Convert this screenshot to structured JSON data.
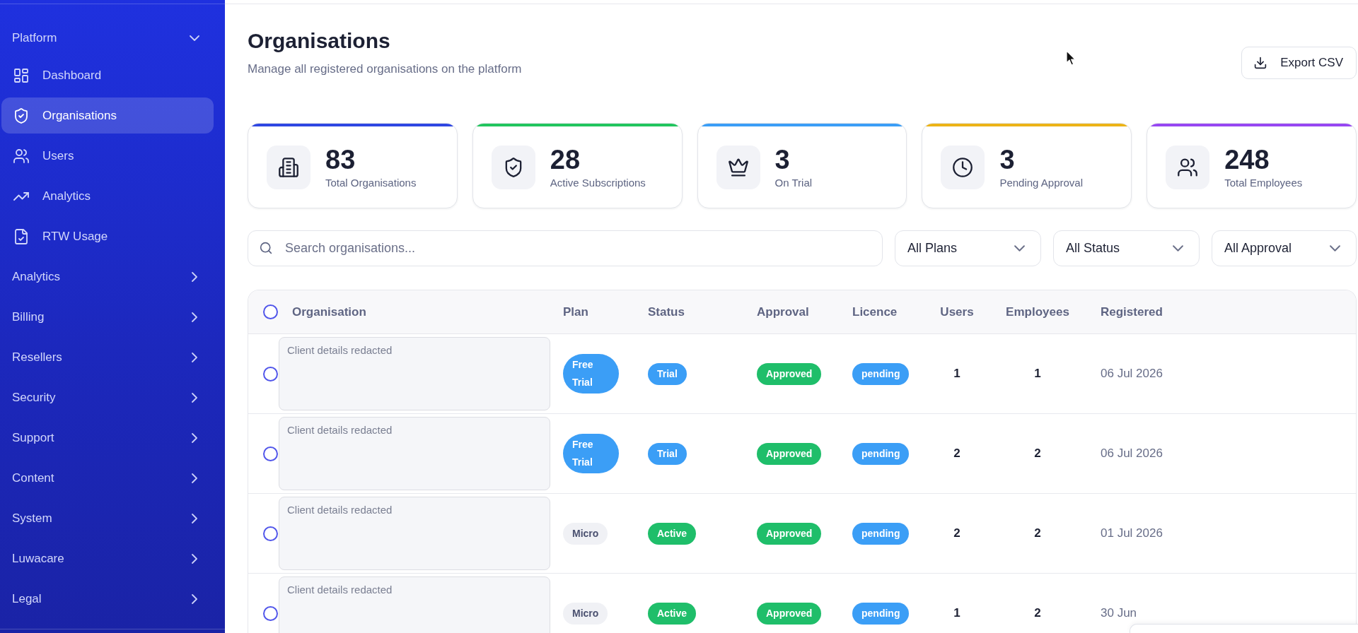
{
  "sidebar": {
    "sections": [
      {
        "label": "Platform",
        "expanded": true,
        "children": [
          {
            "label": "Dashboard",
            "selected": false
          },
          {
            "label": "Organisations",
            "selected": true
          },
          {
            "label": "Users",
            "selected": false
          },
          {
            "label": "Analytics",
            "selected": false
          },
          {
            "label": "RTW Usage",
            "selected": false
          }
        ]
      },
      {
        "label": "Analytics",
        "expanded": false
      },
      {
        "label": "Billing",
        "expanded": false
      },
      {
        "label": "Resellers",
        "expanded": false
      },
      {
        "label": "Security",
        "expanded": false
      },
      {
        "label": "Support",
        "expanded": false
      },
      {
        "label": "Content",
        "expanded": false
      },
      {
        "label": "System",
        "expanded": false
      },
      {
        "label": "Luwacare",
        "expanded": false
      },
      {
        "label": "Legal",
        "expanded": false
      }
    ]
  },
  "header": {
    "title": "Organisations",
    "subtitle": "Manage all registered organisations on the platform",
    "export_button": "Export CSV"
  },
  "stats": [
    {
      "value": "83",
      "label": "Total Organisations",
      "color": "#2f47e2"
    },
    {
      "value": "28",
      "label": "Active Subscriptions",
      "color": "#22c55e"
    },
    {
      "value": "3",
      "label": "On Trial",
      "color": "#3b9ef6"
    },
    {
      "value": "3",
      "label": "Pending Approval",
      "color": "#ecb316"
    },
    {
      "value": "248",
      "label": "Total Employees",
      "color": "#9747f2"
    }
  ],
  "filters": {
    "search": {
      "placeholder": "Search organisations..."
    },
    "dropdowns": [
      {
        "value": "All Plans"
      },
      {
        "value": "All Status"
      },
      {
        "value": "All Approval"
      }
    ]
  },
  "table": {
    "select_all": {
      "checked": false
    },
    "columns": [
      "Organisation",
      "Plan",
      "Status",
      "Approval",
      "Licence",
      "Users",
      "Employees",
      "Registered"
    ],
    "rows": [
      {
        "selected": false,
        "organisation": "Client details redacted",
        "plan": {
          "text": "Free Trial",
          "color": "#3b9ef6"
        },
        "status": {
          "text": "Trial",
          "color": "#3b9ef6"
        },
        "approval": {
          "text": "Approved",
          "color": "#1fbe6a"
        },
        "licence": {
          "text": "pending",
          "color": "#3b9ef6"
        },
        "users": "1",
        "employees": "1",
        "registered": "06 Jul 2026"
      },
      {
        "selected": false,
        "organisation": "Client details redacted",
        "plan": {
          "text": "Free Trial",
          "color": "#3b9ef6"
        },
        "status": {
          "text": "Trial",
          "color": "#3b9ef6"
        },
        "approval": {
          "text": "Approved",
          "color": "#1fbe6a"
        },
        "licence": {
          "text": "pending",
          "color": "#3b9ef6"
        },
        "users": "2",
        "employees": "2",
        "registered": "06 Jul 2026"
      },
      {
        "selected": false,
        "organisation": "Client details redacted",
        "plan": {
          "text": "Micro",
          "color": "#f0f1f5"
        },
        "status": {
          "text": "Active",
          "color": "#1fbe6a"
        },
        "approval": {
          "text": "Approved",
          "color": "#1fbe6a"
        },
        "licence": {
          "text": "pending",
          "color": "#3b9ef6"
        },
        "users": "2",
        "employees": "2",
        "registered": "01 Jul 2026"
      },
      {
        "selected": false,
        "organisation": "Client details redacted",
        "plan": {
          "text": "Micro",
          "color": "#f0f1f5"
        },
        "status": {
          "text": "Active",
          "color": "#1fbe6a"
        },
        "approval": {
          "text": "Approved",
          "color": "#1fbe6a"
        },
        "licence": {
          "text": "pending",
          "color": "#3b9ef6"
        },
        "users": "1",
        "employees": "2",
        "registered": "30 Jun"
      }
    ]
  }
}
